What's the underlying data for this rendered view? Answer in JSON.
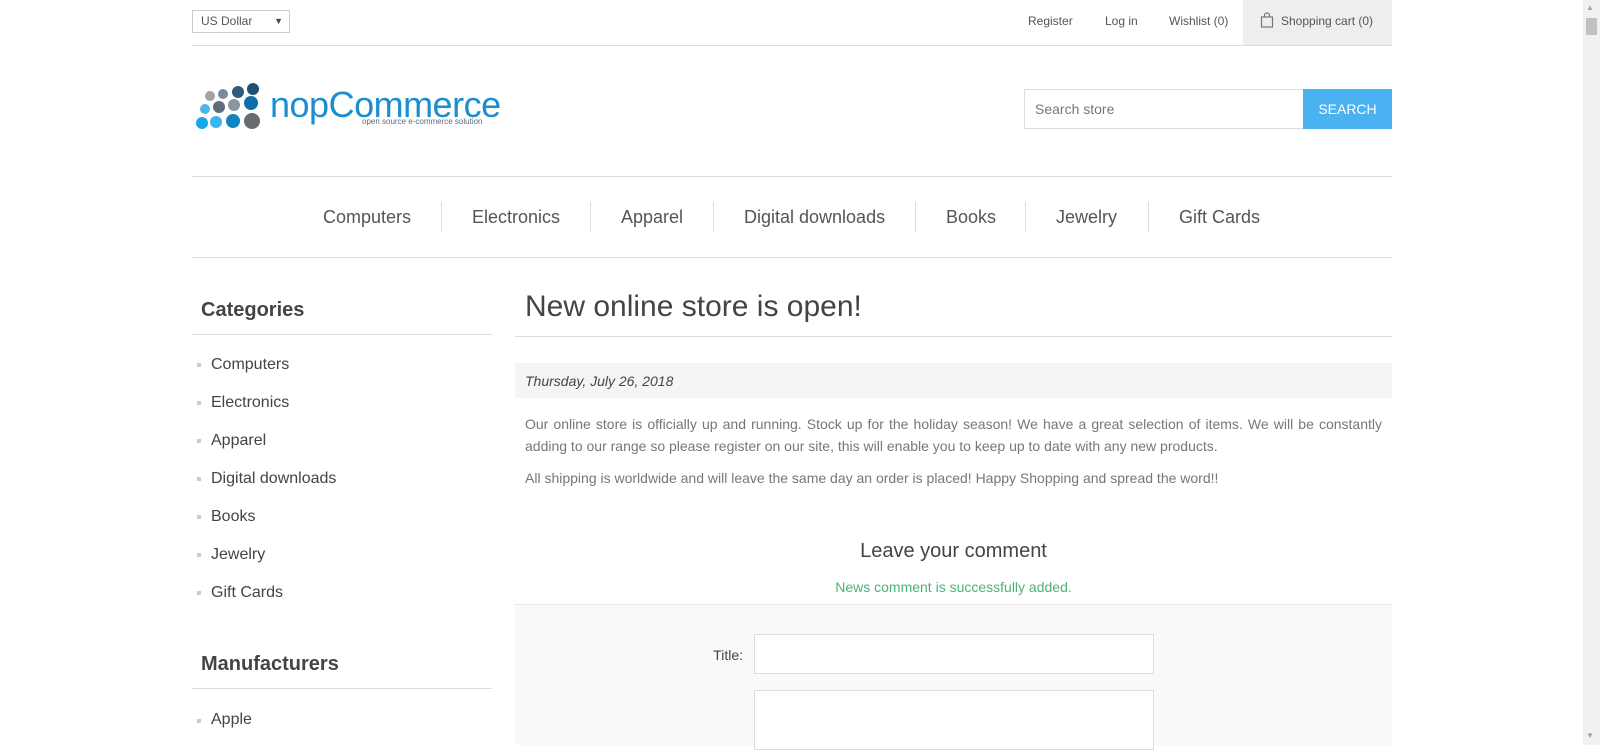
{
  "header": {
    "currency": "US Dollar",
    "links": [
      {
        "label": "Register"
      },
      {
        "label": "Log in"
      },
      {
        "label": "Wishlist (0)"
      }
    ],
    "cart_label": "Shopping cart (0)"
  },
  "logo": {
    "text": "nopCommerce",
    "tagline": "open source e-commerce solution"
  },
  "search": {
    "placeholder": "Search store",
    "button_label": "Search"
  },
  "nav": {
    "items": [
      "Computers",
      "Electronics",
      "Apparel",
      "Digital downloads",
      "Books",
      "Jewelry",
      "Gift Cards"
    ]
  },
  "sidebar": {
    "categories_title": "Categories",
    "categories": [
      "Computers",
      "Electronics",
      "Apparel",
      "Digital downloads",
      "Books",
      "Jewelry",
      "Gift Cards"
    ],
    "manufacturers_title": "Manufacturers",
    "manufacturers": [
      "Apple"
    ]
  },
  "news": {
    "title": "New online store is open!",
    "date": "Thursday, July 26, 2018",
    "paragraph1": "Our online store is officially up and running. Stock up for the holiday season! We have a great selection of items. We will be constantly adding to our range so please register on our site, this will enable you to keep up to date with any new products.",
    "paragraph2": "All shipping is worldwide and will leave the same day an order is placed! Happy Shopping and spread the word!!"
  },
  "comment": {
    "heading": "Leave your comment",
    "success_message": "News comment is successfully added.",
    "title_label": "Title:"
  },
  "colors": {
    "accent": "#4ab2f1",
    "success": "#4cb17c"
  }
}
